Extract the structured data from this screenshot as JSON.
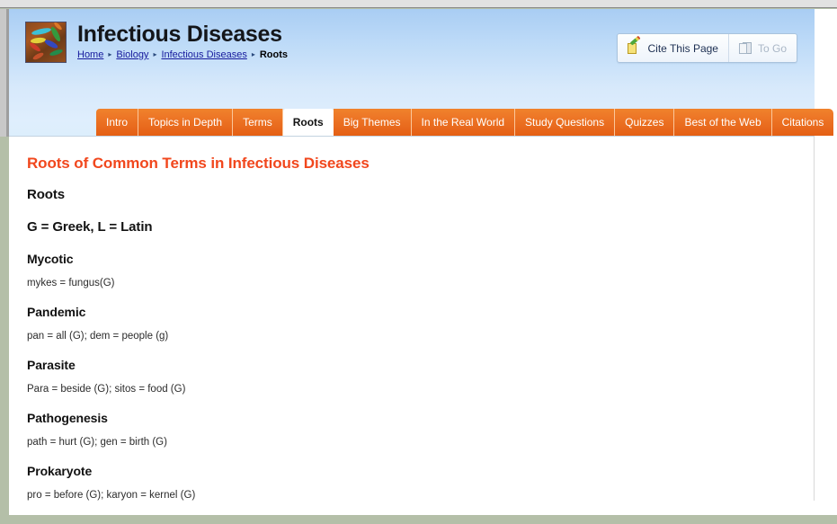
{
  "site": {
    "title": "Infectious Diseases",
    "logo_icon": "bacteria-micrograph-thumbnail"
  },
  "breadcrumb": {
    "items": [
      {
        "label": "Home",
        "is_link": true
      },
      {
        "label": "Biology",
        "is_link": true
      },
      {
        "label": "Infectious Diseases",
        "is_link": true
      },
      {
        "label": "Roots",
        "is_link": false
      }
    ],
    "separator": "▸"
  },
  "header_actions": {
    "cite": {
      "label": "Cite This Page",
      "icon": "pencil-paper-icon",
      "enabled": true
    },
    "to_go": {
      "label": "To Go",
      "icon": "book-icon",
      "enabled": false
    }
  },
  "tabs": [
    {
      "label": "Intro",
      "active": false
    },
    {
      "label": "Topics in Depth",
      "active": false
    },
    {
      "label": "Terms",
      "active": false
    },
    {
      "label": "Roots",
      "active": true
    },
    {
      "label": "Big Themes",
      "active": false
    },
    {
      "label": "In the Real World",
      "active": false
    },
    {
      "label": "Study Questions",
      "active": false
    },
    {
      "label": "Quizzes",
      "active": false
    },
    {
      "label": "Best of the Web",
      "active": false
    },
    {
      "label": "Citations",
      "active": false
    }
  ],
  "content": {
    "page_heading": "Roots of Common Terms in Infectious Diseases",
    "section_heading": "Roots",
    "legend": "G = Greek, L = Latin",
    "entries": [
      {
        "term": "Mycotic",
        "definition": "mykes = fungus(G)"
      },
      {
        "term": "Pandemic",
        "definition": "pan = all (G); dem = people (g)"
      },
      {
        "term": "Parasite",
        "definition": "Para = beside (G); sitos = food (G)"
      },
      {
        "term": "Pathogenesis",
        "definition": "path = hurt (G); gen = birth (G)"
      },
      {
        "term": "Prokaryote",
        "definition": "pro = before (G); karyon = kernel (G)"
      }
    ]
  },
  "colors": {
    "accent_orange": "#e45f14",
    "heading_orange": "#f1471d",
    "link_blue": "#15199c",
    "header_blue_top": "#a9cdf3",
    "header_blue_bottom": "#dceefc",
    "desktop_green": "#b4bfa8"
  }
}
